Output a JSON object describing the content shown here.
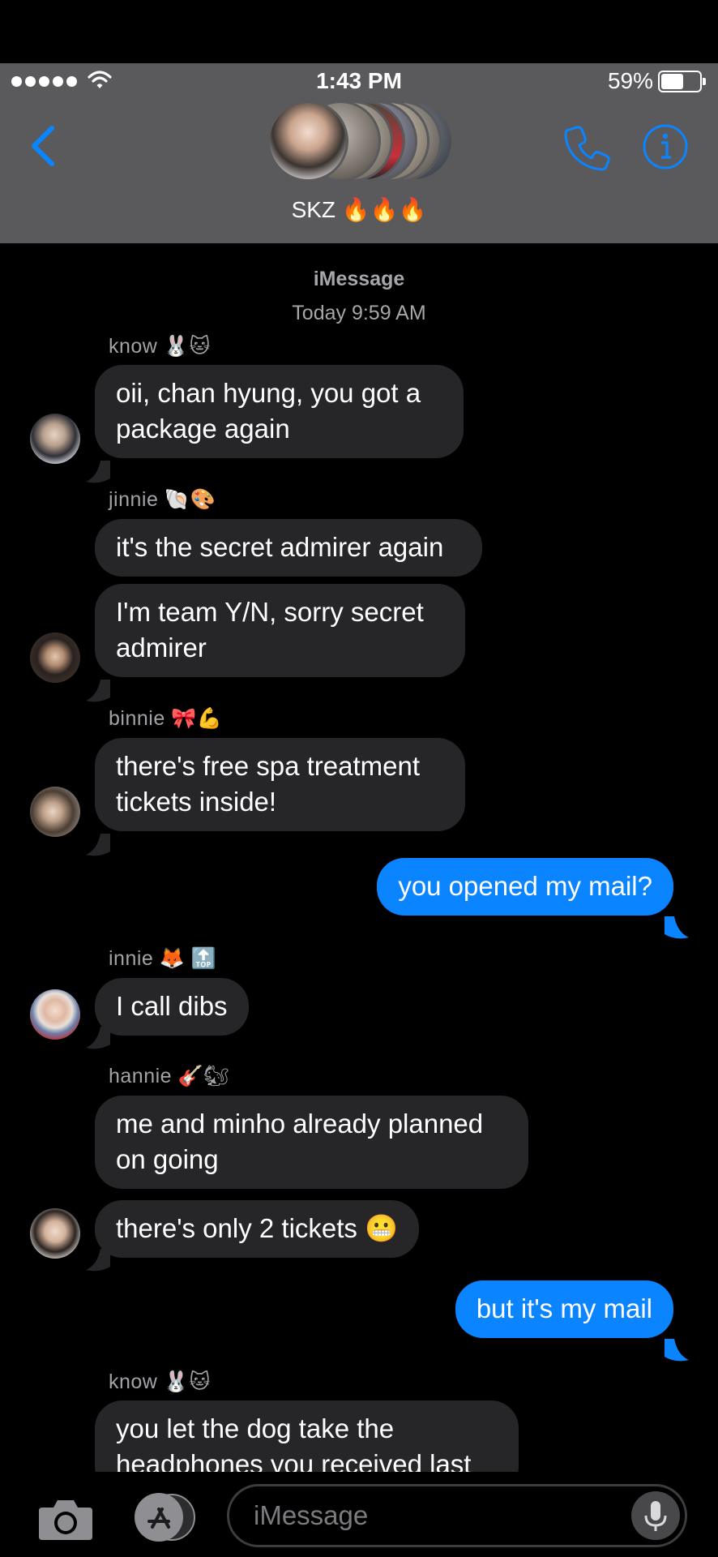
{
  "status_bar": {
    "time": "1:43 PM",
    "battery_percent": "59%",
    "battery_level": 0.59
  },
  "header": {
    "group_name": "SKZ 🔥🔥🔥",
    "back_icon": "chevron-left-icon",
    "call_icon": "phone-icon",
    "info_icon": "info-icon"
  },
  "thread": {
    "service": "iMessage",
    "timestamp": "Today 9:59 AM",
    "groups": [
      {
        "sender": "know 🐰🐱",
        "messages": [
          "oii, chan hyung, you got a package again"
        ]
      },
      {
        "sender": "jinnie 🐚🎨",
        "messages": [
          "it's the secret admirer again",
          "I'm team Y/N, sorry secret admirer"
        ]
      },
      {
        "sender": "binnie 🎀💪",
        "messages": [
          "there's free spa treatment tickets inside!"
        ]
      },
      {
        "outgoing": "you opened my mail?"
      },
      {
        "sender": "innie 🦊 🔝",
        "messages": [
          "I call dibs"
        ]
      },
      {
        "sender": "hannie 🎸🐿",
        "messages": [
          "me and minho already planned on going",
          "there's only 2 tickets 😬"
        ]
      },
      {
        "outgoing": "but it's my mail"
      },
      {
        "sender": "know 🐰🐱",
        "messages": [
          "you let the dog take the headphones you received last"
        ]
      }
    ]
  },
  "composer": {
    "placeholder": "iMessage",
    "camera_icon": "camera-icon",
    "apps_icon": "app-store-icon",
    "mic_icon": "microphone-icon"
  },
  "colors": {
    "header_bg": "#5a5a5c",
    "accent": "#0a84ff",
    "incoming_bubble": "#262629",
    "background": "#000000"
  }
}
